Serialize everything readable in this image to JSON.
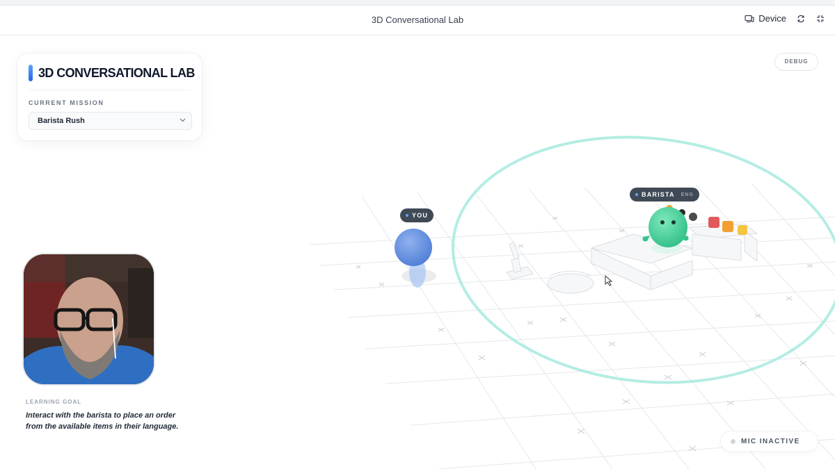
{
  "window": {
    "title": "3D Conversational Lab",
    "device_label": "Device"
  },
  "lab": {
    "title": "3D CONVERSATIONAL LAB",
    "mission_label": "CURRENT MISSION",
    "mission_value": "Barista Rush"
  },
  "debug_label": "DEBUG",
  "scene": {
    "you_tag": "YOU",
    "barista_tag": "BARISTA",
    "barista_lang": "ENG"
  },
  "goal": {
    "label": "LEARNING GOAL",
    "text": "Interact with the barista to place an order from the available items in their language."
  },
  "mic": {
    "status": "MIC INACTIVE"
  },
  "colors": {
    "accent_blue": "#3b82f6",
    "barista_green": "#3ecf9a",
    "ring_teal": "#a7eadf",
    "tag_bg": "#3f4a56"
  },
  "icons": [
    "device-icon",
    "refresh-icon",
    "fullscreen-icon",
    "chevron-down-icon",
    "cursor-icon"
  ]
}
